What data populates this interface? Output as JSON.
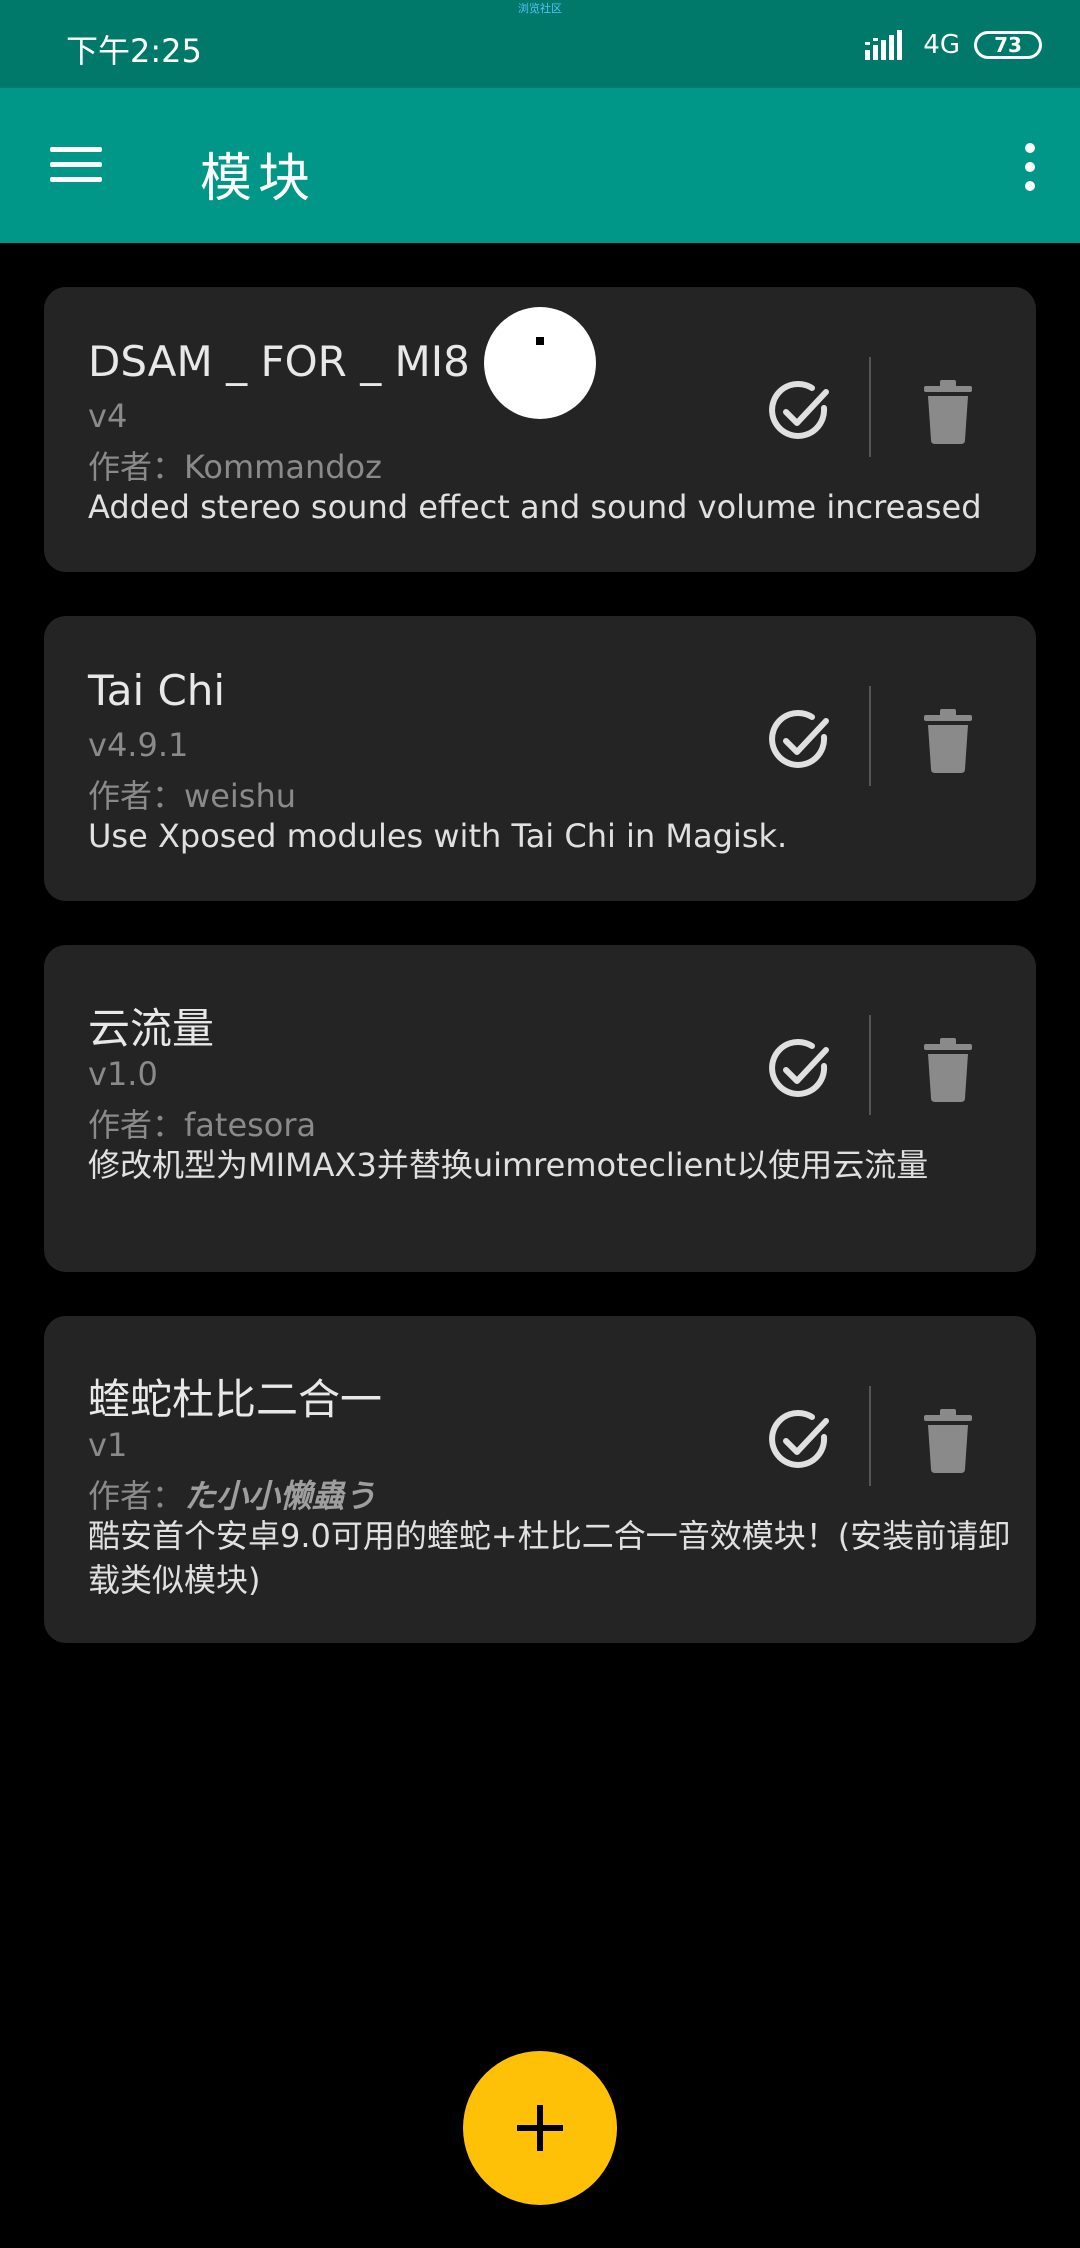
{
  "status_bar": {
    "time": "下午2:25",
    "tiny_label": "浏览社区",
    "network": "4G",
    "battery": "73"
  },
  "toolbar": {
    "title": "模块"
  },
  "modules": [
    {
      "title": "DSAM _ FOR _ MI8",
      "version": "v4",
      "author_prefix": "作者：",
      "author": "Kommandoz",
      "description": "Added stereo sound effect and sound volume increased"
    },
    {
      "title": "Tai Chi",
      "version": "v4.9.1",
      "author_prefix": "作者：",
      "author": "weishu",
      "description": "Use Xposed modules with Tai Chi in Magisk."
    },
    {
      "title": "云流量",
      "version": "v1.0",
      "author_prefix": "作者：",
      "author": "fatesora",
      "description": "修改机型为MIMAX3并替换uimremoteclient以使用云流量"
    },
    {
      "title": "蝰蛇杜比二合一",
      "version": "v1",
      "author_prefix": "作者：",
      "author": "た小小懒蟲う",
      "description": "酷安首个安卓9.0可用的蝰蛇+杜比二合一音效模块！(安装前请卸载类似模块)"
    }
  ],
  "colors": {
    "status_bar": "#00796b",
    "toolbar": "#009688",
    "card": "#242424",
    "fab": "#ffc107"
  },
  "fab": {
    "icon": "plus-icon"
  }
}
